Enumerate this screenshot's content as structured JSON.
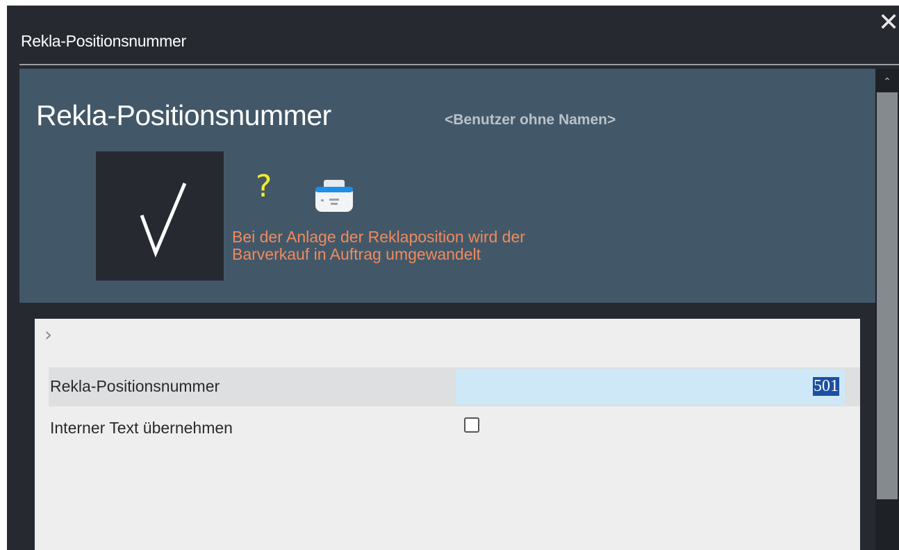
{
  "window": {
    "title": "Rekla-Positionsnummer",
    "close_icon": "✕"
  },
  "header": {
    "title": "Rekla-Positionsnummer",
    "user": "<Benutzer ohne Namen>",
    "confirm_icon": "checkmark-icon",
    "help_icon": "?",
    "print_icon": "printer-icon",
    "warning_line1": "Bei der Anlage der Reklaposition wird der",
    "warning_line2": "Barverkauf in Auftrag umgewandelt",
    "warning_color": "#f08a5d",
    "panel_color": "#425868"
  },
  "form": {
    "expand_icon": "›",
    "fields": [
      {
        "label": "Rekla-Positionsnummer",
        "value": "501"
      },
      {
        "label": "Interner Text übernehmen",
        "checked": false
      }
    ]
  },
  "scrollbar": {
    "up_icon": "⌃"
  }
}
